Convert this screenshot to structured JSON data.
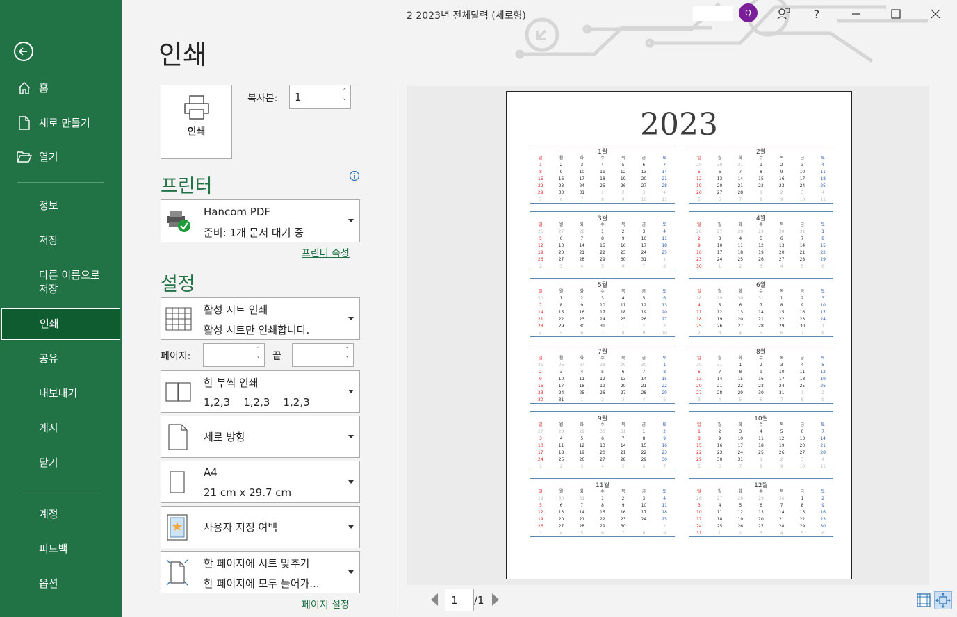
{
  "window": {
    "title": "2 2023년 전체달력 (세로형)",
    "avatar_initial": "Q",
    "help_label": "?"
  },
  "nav": {
    "items": [
      {
        "label": "홈",
        "icon": "home-icon"
      },
      {
        "label": "새로 만들기",
        "icon": "new-file-icon"
      },
      {
        "label": "열기",
        "icon": "folder-open-icon"
      },
      {
        "label": "정보"
      },
      {
        "label": "저장"
      },
      {
        "label": "다른 이름으로\n저장"
      },
      {
        "label": "인쇄"
      },
      {
        "label": "공유"
      },
      {
        "label": "내보내기"
      },
      {
        "label": "게시"
      },
      {
        "label": "닫기"
      },
      {
        "label": "계정"
      },
      {
        "label": "피드백"
      },
      {
        "label": "옵션"
      }
    ]
  },
  "print": {
    "heading": "인쇄",
    "button_label": "인쇄",
    "copies_label": "복사본:",
    "copies_value": "1"
  },
  "printer": {
    "section_title": "프린터",
    "name": "Hancom PDF",
    "status": "준비: 1개 문서 대기 중",
    "properties_link": "프린터 속성"
  },
  "settings": {
    "section_title": "설정",
    "scope_title": "활성 시트 인쇄",
    "scope_desc": "활성 시트만 인쇄합니다.",
    "pages_label": "페이지:",
    "pages_from": "",
    "pages_to_label": "끝",
    "pages_to": "",
    "collate_title": "한 부씩 인쇄",
    "collate_desc": "1,2,3    1,2,3    1,2,3",
    "orientation": "세로 방향",
    "paper_title": "A4",
    "paper_desc": "21 cm x 29.7 cm",
    "margins": "사용자 지정 여백",
    "scaling_title": "한 페이지에 시트 맞추기",
    "scaling_desc": "한 페이지에 모두 들어가...",
    "page_setup_link": "페이지 설정"
  },
  "preview": {
    "year": "2023",
    "weekdays": [
      "일",
      "월",
      "화",
      "수",
      "목",
      "금",
      "토"
    ],
    "months": [
      {
        "name": "1월",
        "lead": 0,
        "days": 31,
        "prev_days": 31
      },
      {
        "name": "2월",
        "lead": 3,
        "days": 28,
        "prev_days": 31
      },
      {
        "name": "3월",
        "lead": 3,
        "days": 31,
        "prev_days": 28
      },
      {
        "name": "4월",
        "lead": 6,
        "days": 30,
        "prev_days": 31
      },
      {
        "name": "5월",
        "lead": 1,
        "days": 31,
        "prev_days": 30
      },
      {
        "name": "6월",
        "lead": 4,
        "days": 30,
        "prev_days": 31
      },
      {
        "name": "7월",
        "lead": 6,
        "days": 31,
        "prev_days": 30
      },
      {
        "name": "8월",
        "lead": 2,
        "days": 31,
        "prev_days": 31
      },
      {
        "name": "9월",
        "lead": 5,
        "days": 30,
        "prev_days": 31
      },
      {
        "name": "10월",
        "lead": 0,
        "days": 31,
        "prev_days": 30
      },
      {
        "name": "11월",
        "lead": 3,
        "days": 30,
        "prev_days": 31
      },
      {
        "name": "12월",
        "lead": 5,
        "days": 31,
        "prev_days": 30
      }
    ],
    "current_page": "1",
    "total_pages": "/1"
  },
  "colors": {
    "accent": "#217346",
    "nav_active": "#0e5c2f",
    "sunday": "#dd2222",
    "saturday": "#2e5fb0",
    "rule": "#5b8ab5"
  }
}
